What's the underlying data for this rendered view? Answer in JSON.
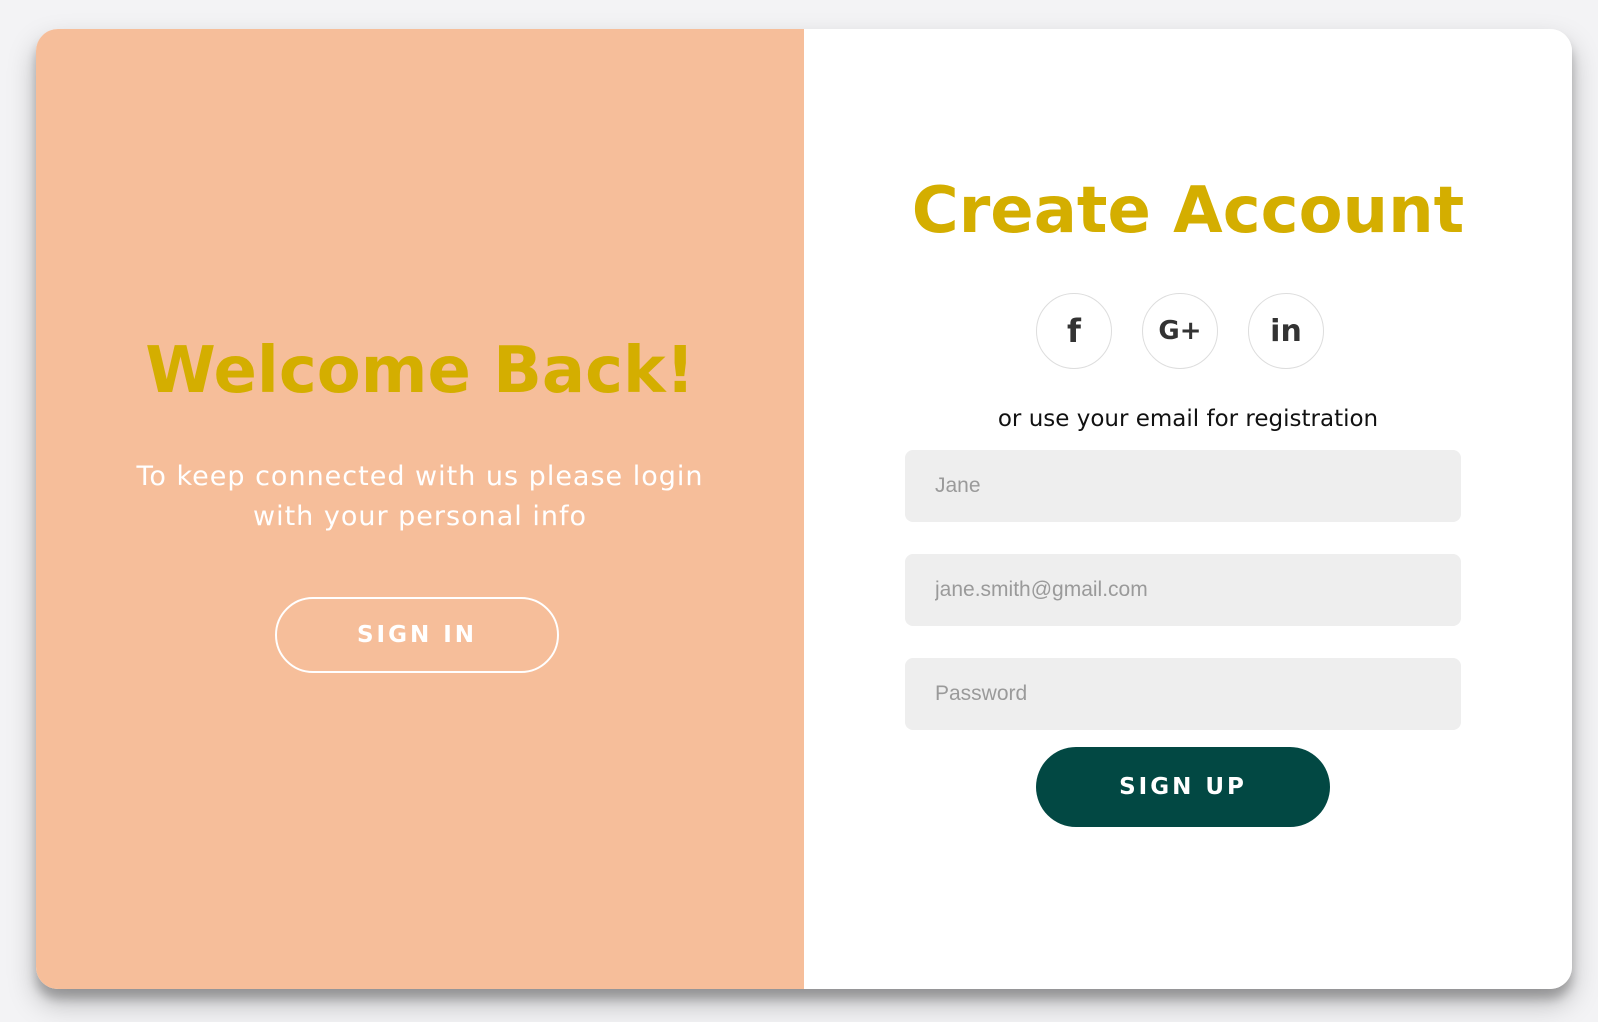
{
  "overlay": {
    "title": "Welcome Back!",
    "message": "To keep connected with us please login with your personal info",
    "sign_in_label": "SIGN IN"
  },
  "signup": {
    "title": "Create Account",
    "social": {
      "facebook_glyph": "f",
      "google_glyph": "G+",
      "linkedin_glyph": "in"
    },
    "helper_text": "or use your email for registration",
    "fields": {
      "name_placeholder": "Jane",
      "email_placeholder": "jane.smith@gmail.com",
      "password_placeholder": "Password"
    },
    "sign_up_label": "SIGN UP"
  },
  "colors": {
    "overlay_bg": "#f6be9a",
    "title_accent": "#d4ae00",
    "primary_button": "#024843",
    "input_bg": "#eeeeee"
  },
  "icons": [
    "facebook-icon",
    "google-plus-icon",
    "linkedin-icon"
  ]
}
